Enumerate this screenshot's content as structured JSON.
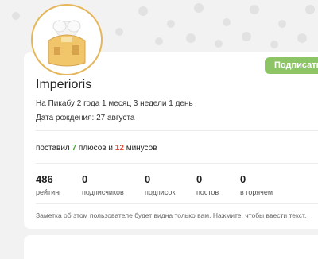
{
  "profile": {
    "username": "Imperioris",
    "on_site": "На Пикабу 2 года 1 месяц 3 недели 1 день",
    "birthday": "Дата рождения: 27 августа",
    "subscribe_label": "Подписаться",
    "avatar_icon": "chef-house-icon"
  },
  "votes": {
    "prefix": "поставил",
    "plus_count": "7",
    "plus_label": "плюсов",
    "conj": "и",
    "minus_count": "12",
    "minus_label": "минусов"
  },
  "stats": [
    {
      "value": "486",
      "label": "рейтинг"
    },
    {
      "value": "0",
      "label": "подписчиков"
    },
    {
      "value": "0",
      "label": "подписок"
    },
    {
      "value": "0",
      "label": "постов"
    },
    {
      "value": "0",
      "label": "в горячем"
    }
  ],
  "note": "Заметка об этом пользователе будет видна только вам. Нажмите, чтобы ввести текст.",
  "colors": {
    "accent": "#8dc566",
    "plus": "#4ea528",
    "minus": "#e24a3b",
    "avatar_ring": "#e6b65a"
  }
}
